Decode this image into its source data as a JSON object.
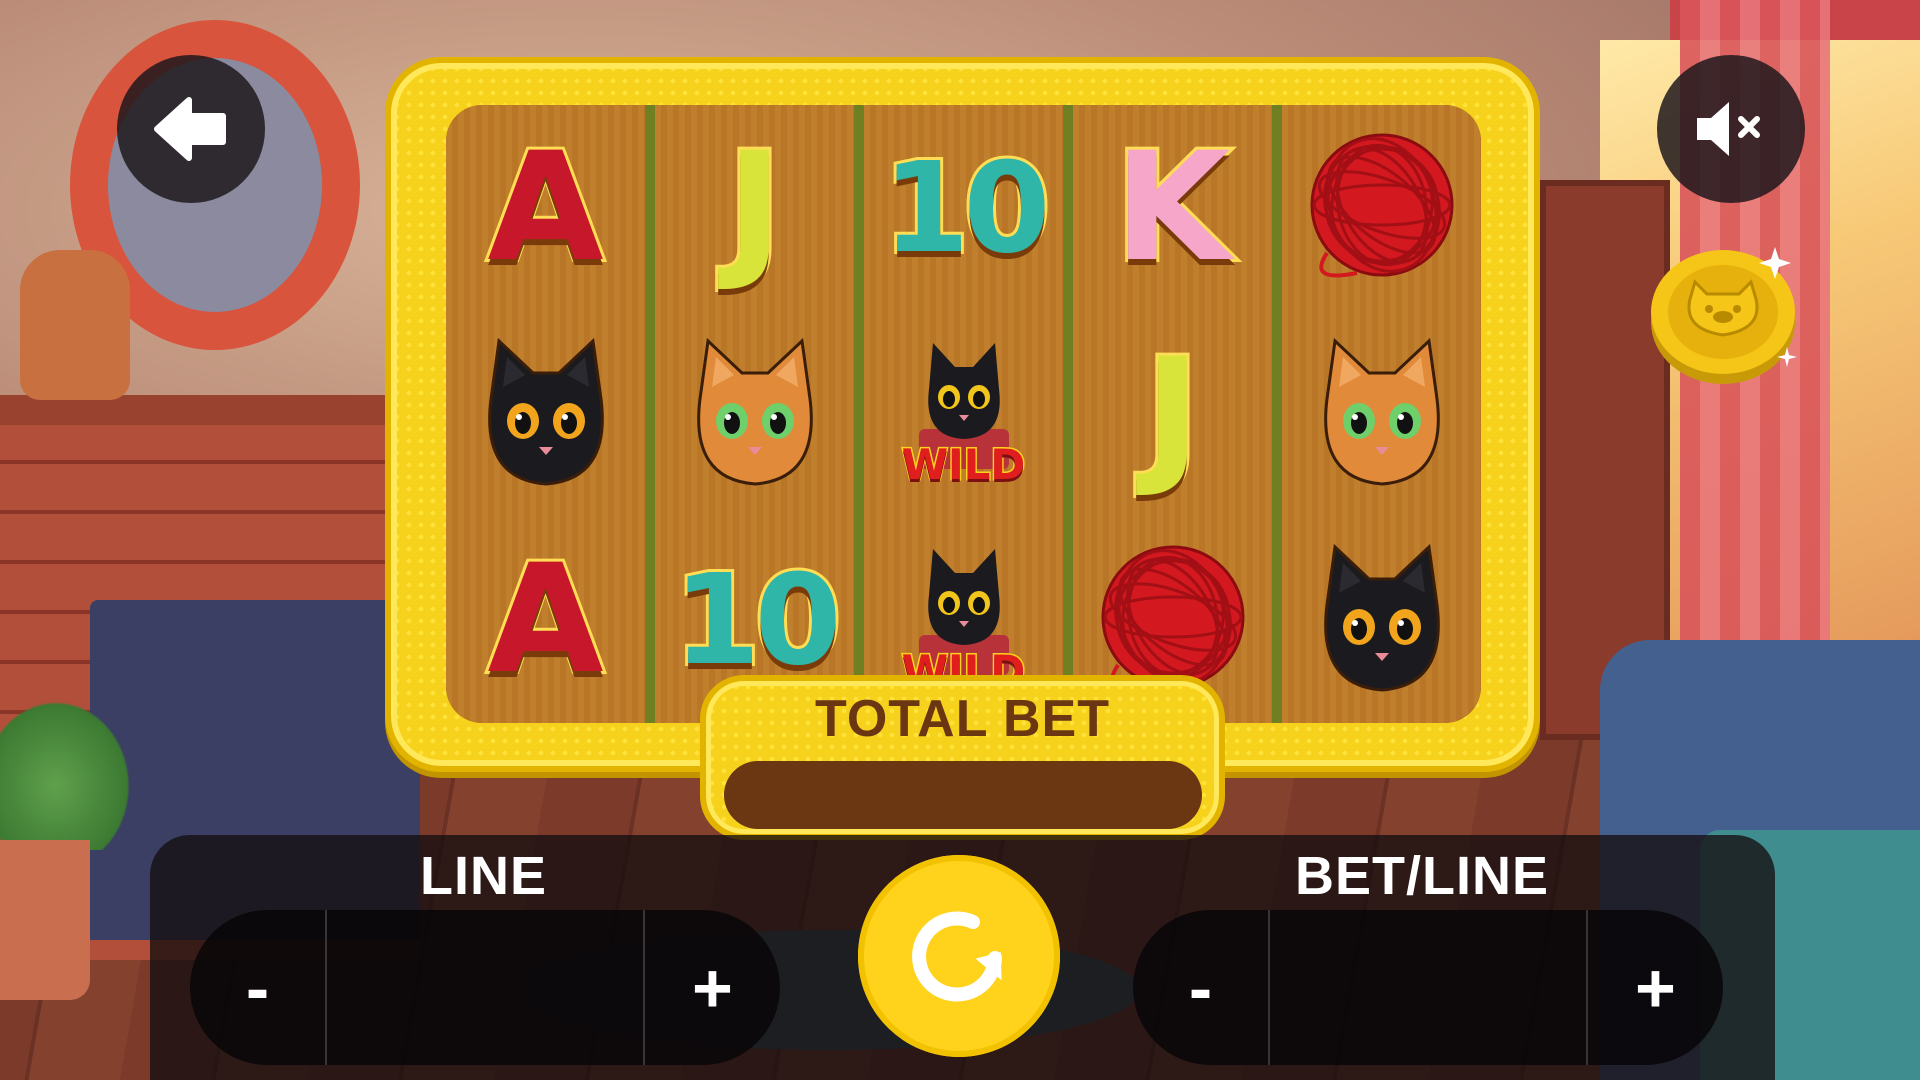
{
  "colors": {
    "frame": "#f7d21c",
    "frame_dark": "#e2b400",
    "reel_bg": "#c07f2c",
    "reel_divider": "#6f7f22",
    "total_bet_text": "#6b3612",
    "spin": "#ffd21c",
    "button_bg": "#1e181c"
  },
  "top_bar": {
    "back_icon": "back-arrow-icon",
    "mute_icon": "speaker-muted-icon",
    "coin_icon": "cat-coin-icon"
  },
  "reels": [
    {
      "symbols": [
        {
          "type": "letter",
          "text": "A",
          "style": "red-plaid"
        },
        {
          "type": "cat",
          "name": "black-cat"
        },
        {
          "type": "letter",
          "text": "A",
          "style": "red-plaid"
        }
      ]
    },
    {
      "symbols": [
        {
          "type": "letter",
          "text": "J",
          "style": "yellow-pattern"
        },
        {
          "type": "cat",
          "name": "orange-cat"
        },
        {
          "type": "letter",
          "text": "10",
          "style": "teal-plaid"
        }
      ]
    },
    {
      "symbols": [
        {
          "type": "letter",
          "text": "10",
          "style": "teal-plaid"
        },
        {
          "type": "wild",
          "text": "WILD"
        },
        {
          "type": "wild",
          "text": "WILD"
        }
      ]
    },
    {
      "symbols": [
        {
          "type": "letter",
          "text": "K",
          "style": "pink-dots"
        },
        {
          "type": "letter",
          "text": "J",
          "style": "yellow-pattern"
        },
        {
          "type": "yarn",
          "name": "yarn-ball"
        }
      ]
    },
    {
      "symbols": [
        {
          "type": "yarn",
          "name": "yarn-ball"
        },
        {
          "type": "cat",
          "name": "orange-cat"
        },
        {
          "type": "cat",
          "name": "black-cat"
        }
      ]
    }
  ],
  "total_bet": {
    "label": "TOTAL BET",
    "value": ""
  },
  "line": {
    "label": "LINE",
    "minus": "-",
    "plus": "+",
    "value": ""
  },
  "bet_line": {
    "label": "BET/LINE",
    "minus": "-",
    "plus": "+",
    "value": ""
  },
  "spin": {
    "icon": "spin-arrow-icon"
  }
}
